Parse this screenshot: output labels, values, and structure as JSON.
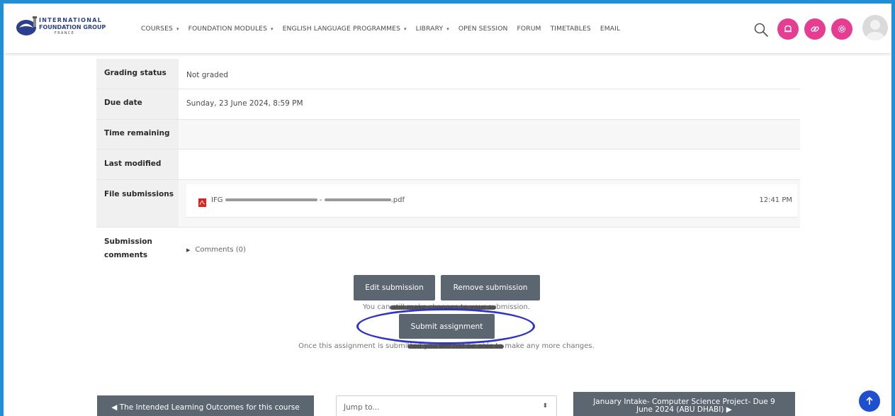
{
  "brand": {
    "line1": "INTERNATIONAL",
    "line2": "FOUNDATION GROUP",
    "line3": "FRANCE"
  },
  "nav": {
    "items": [
      {
        "label": "COURSES",
        "dropdown": true
      },
      {
        "label": "FOUNDATION MODULES",
        "dropdown": true
      },
      {
        "label": "ENGLISH LANGUAGE PROGRAMMES",
        "dropdown": true
      },
      {
        "label": "LIBRARY",
        "dropdown": true
      },
      {
        "label": "OPEN SESSION",
        "dropdown": false
      },
      {
        "label": "FORUM",
        "dropdown": false
      },
      {
        "label": "TIMETABLES",
        "dropdown": false
      },
      {
        "label": "EMAIL",
        "dropdown": false
      }
    ],
    "icons": [
      "search-icon",
      "notifications-icon",
      "link-icon",
      "settings-icon",
      "user-avatar"
    ],
    "accent_color": "#e63d92"
  },
  "status": {
    "grading_status_label": "Grading status",
    "grading_status_value": "Not graded",
    "due_date_label": "Due date",
    "due_date_value": "Sunday, 23 June 2024, 8:59 PM",
    "time_remaining_label": "Time remaining",
    "time_remaining_value": "",
    "last_modified_label": "Last modified",
    "last_modified_value": "",
    "file_submissions_label": "File submissions",
    "file": {
      "prefix": "IFG",
      "separator": "-",
      "extension": ".pdf",
      "time": "12:41 PM"
    },
    "submission_comments_label_1": "Submission",
    "submission_comments_label_2": "comments",
    "comments_link": "Comments (0)"
  },
  "actions": {
    "edit_label": "Edit submission",
    "remove_label": "Remove submission",
    "edit_note": "You can still make changes to your submission.",
    "submit_label": "Submit assignment",
    "submit_note": "Once this assignment is submitted you will not be able to make any more changes."
  },
  "footer": {
    "prev_label": "◀ The Intended Learning Outcomes for this course",
    "jump_placeholder": "Jump to...",
    "next_label_1": "January Intake- Computer Science Project- Due 9",
    "next_label_2": "June 2024 (ABU DHABI) ▶"
  },
  "colors": {
    "button_bg": "#5c6670",
    "highlight_ellipse": "#2d34c7",
    "scroll_top_bg": "#1f4fd1",
    "frame_border": "#1f8fd6"
  }
}
